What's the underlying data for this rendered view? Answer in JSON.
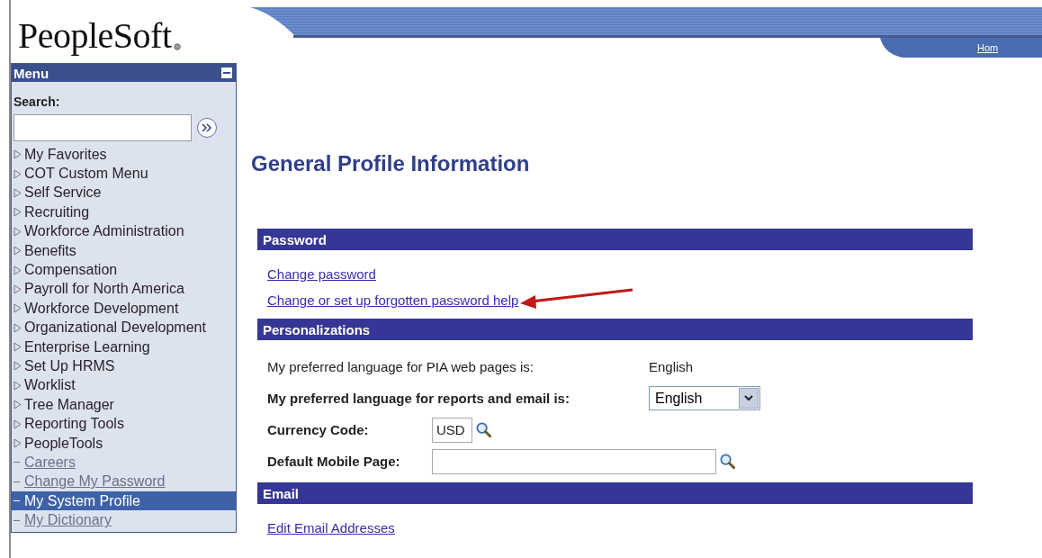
{
  "logo": {
    "text": "PeopleSoft"
  },
  "header": {
    "home_link": "Hom"
  },
  "menu": {
    "title": "Menu",
    "search_label": "Search:",
    "items": [
      {
        "label": "My Favorites",
        "kind": "folder",
        "selected": false
      },
      {
        "label": "COT Custom Menu",
        "kind": "folder",
        "selected": false
      },
      {
        "label": "Self Service",
        "kind": "folder",
        "selected": false
      },
      {
        "label": "Recruiting",
        "kind": "folder",
        "selected": false
      },
      {
        "label": "Workforce Administration",
        "kind": "folder",
        "selected": false
      },
      {
        "label": "Benefits",
        "kind": "folder",
        "selected": false
      },
      {
        "label": "Compensation",
        "kind": "folder",
        "selected": false
      },
      {
        "label": "Payroll for North America",
        "kind": "folder",
        "selected": false
      },
      {
        "label": "Workforce Development",
        "kind": "folder",
        "selected": false
      },
      {
        "label": "Organizational Development",
        "kind": "folder",
        "selected": false
      },
      {
        "label": "Enterprise Learning",
        "kind": "folder",
        "selected": false
      },
      {
        "label": "Set Up HRMS",
        "kind": "folder",
        "selected": false
      },
      {
        "label": "Worklist",
        "kind": "folder",
        "selected": false
      },
      {
        "label": "Tree Manager",
        "kind": "folder",
        "selected": false
      },
      {
        "label": "Reporting Tools",
        "kind": "folder",
        "selected": false
      },
      {
        "label": "PeopleTools",
        "kind": "folder",
        "selected": false
      },
      {
        "label": "Careers",
        "kind": "link",
        "selected": false
      },
      {
        "label": "Change My Password",
        "kind": "link",
        "selected": false
      },
      {
        "label": "My System Profile",
        "kind": "link",
        "selected": true
      },
      {
        "label": "My Dictionary",
        "kind": "link",
        "selected": false
      }
    ]
  },
  "title": "General Profile Information",
  "sections": [
    {
      "title": "Password",
      "rows": [
        {
          "kind": "link",
          "label": "Change password",
          "annotated": false
        },
        {
          "kind": "link",
          "label": "Change or set up forgotten password help",
          "annotated": true
        }
      ]
    },
    {
      "title": "Personalizations",
      "rows": [
        {
          "kind": "text",
          "label": "My preferred language for PIA web pages is:",
          "value": "English"
        },
        {
          "kind": "select",
          "label": "My preferred language for reports and email is:",
          "value": "English"
        },
        {
          "kind": "code",
          "label": "Currency Code:",
          "value": "USD"
        },
        {
          "kind": "lookup",
          "label": "Default Mobile Page:"
        }
      ]
    },
    {
      "title": "Email",
      "rows": [
        {
          "kind": "link",
          "label": "Edit Email Addresses",
          "annotated": false
        }
      ]
    }
  ]
}
